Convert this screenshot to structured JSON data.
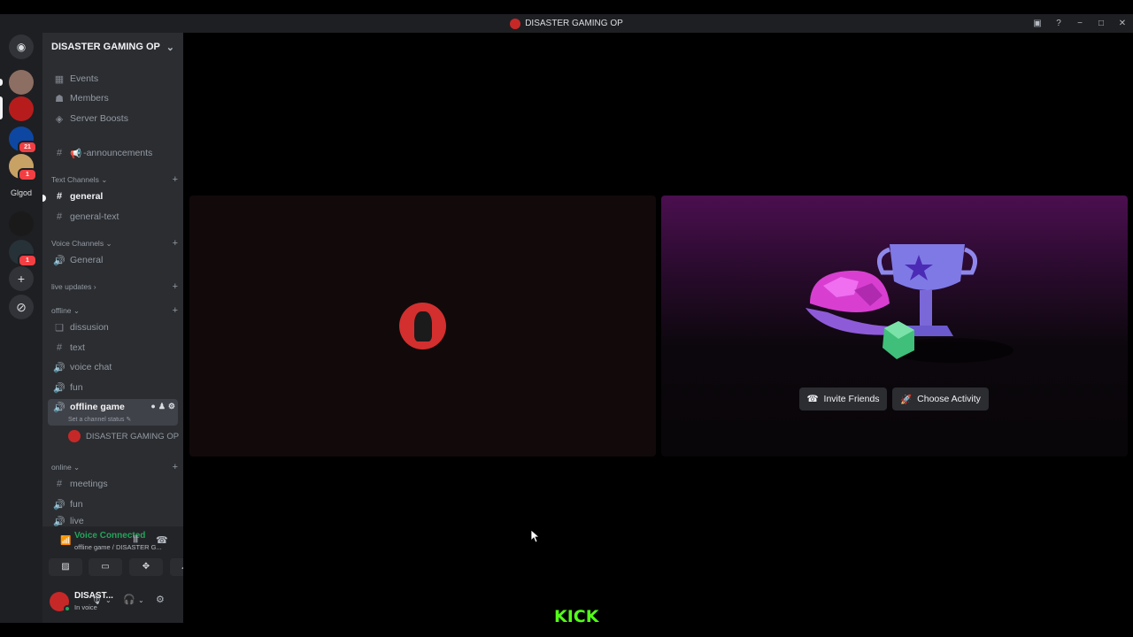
{
  "window": {
    "title": "DISASTER GAMING OP",
    "controls": [
      "minimize",
      "maximize",
      "close"
    ]
  },
  "guilds": {
    "items": [
      {
        "name": "discord-home",
        "badge": ""
      },
      {
        "name": "server-1",
        "badge": ""
      },
      {
        "name": "server-2",
        "badge": ""
      },
      {
        "name": "server-3",
        "badge": "21"
      },
      {
        "name": "server-4",
        "badge": "1"
      },
      {
        "name": "server-5",
        "badge": ""
      },
      {
        "name": "server-6",
        "badge": "1"
      }
    ],
    "text_item": "Glgod",
    "colors": [
      "#5865f2",
      "#8d6e63",
      "#b71c1c",
      "#0d47a1",
      "#c8a165",
      "#1a1a1a",
      "#263238"
    ]
  },
  "server": {
    "name": "DISASTER GAMING OP",
    "chevron": "v",
    "top_items": [
      {
        "label": "Events",
        "icon": "calendar-icon"
      },
      {
        "label": "Members",
        "icon": "members-icon"
      },
      {
        "label": "Server Boosts",
        "icon": "boost-icon"
      }
    ],
    "announcements": "-announcements",
    "categories": {
      "text": "Text Channels",
      "voice": "Voice Channels",
      "live": "live updates",
      "offline": "offline",
      "online": "online"
    },
    "text_channels": [
      "general",
      "general-text"
    ],
    "voice_channels": [
      "General"
    ],
    "offline_channels": [
      "dissusion",
      "text",
      "voice chat",
      "fun",
      "offline game"
    ],
    "offline_game_status": "Set a channel status",
    "voice_user": "DISASTER GAMING OP",
    "online_channels": [
      "meetings",
      "fun",
      "live"
    ]
  },
  "voice_panel": {
    "title": "Voice Connected",
    "subtitle": "offline game / DISASTER G..."
  },
  "user_panel": {
    "name": "DISAST...",
    "status": "In voice"
  },
  "stage": {
    "invite_label": "Invite Friends",
    "activity_label": "Choose Activity"
  },
  "watermark": "KICK"
}
